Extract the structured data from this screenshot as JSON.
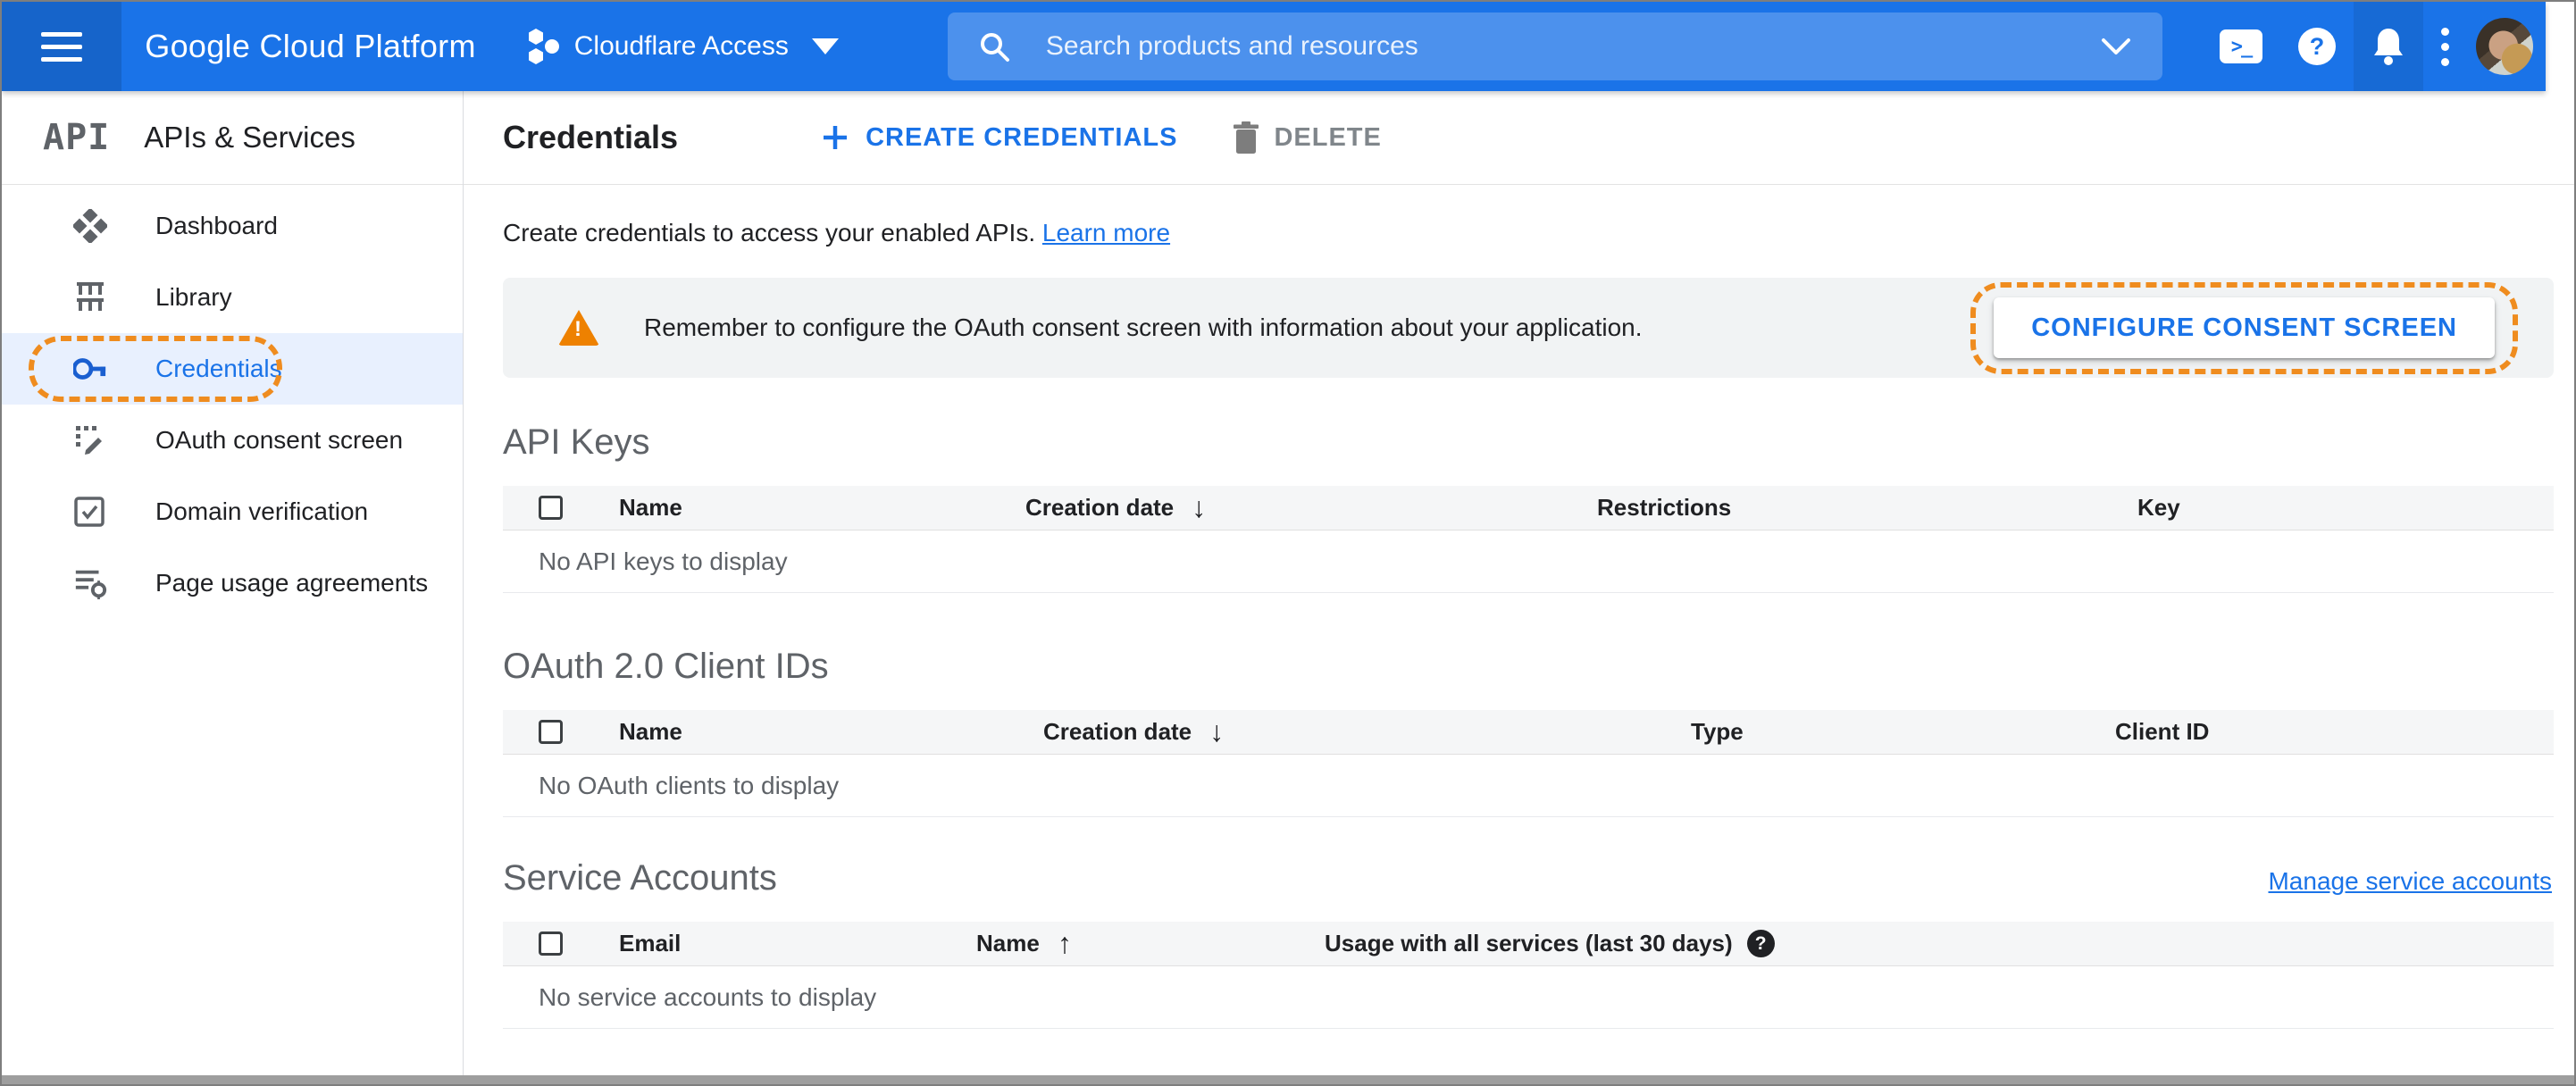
{
  "topbar": {
    "brand": "Google Cloud Platform",
    "project": "Cloudflare Access",
    "search_placeholder": "Search products and resources"
  },
  "sidebar": {
    "product_glyph": "API",
    "title": "APIs & Services",
    "items": [
      {
        "label": "Dashboard",
        "active": false
      },
      {
        "label": "Library",
        "active": false
      },
      {
        "label": "Credentials",
        "active": true,
        "annotated": "orange-dashed-highlight"
      },
      {
        "label": "OAuth consent screen",
        "active": false
      },
      {
        "label": "Domain verification",
        "active": false
      },
      {
        "label": "Page usage agreements",
        "active": false
      }
    ]
  },
  "main": {
    "toolbar": {
      "title": "Credentials",
      "create_label": "CREATE CREDENTIALS",
      "delete_label": "DELETE",
      "delete_enabled": false
    },
    "description": {
      "text": "Create credentials to access your enabled APIs.",
      "link_label": "Learn more"
    },
    "banner": {
      "message": "Remember to configure the OAuth consent screen with information about your application.",
      "action_label": "CONFIGURE CONSENT SCREEN",
      "annotated": "orange-dashed-highlight"
    },
    "sections": [
      {
        "title": "API Keys",
        "columns": [
          {
            "label": "Name"
          },
          {
            "label": "Creation date",
            "sort": "desc",
            "sort_icon": "↓"
          },
          {
            "label": "Restrictions"
          },
          {
            "label": "Key"
          }
        ],
        "empty": "No API keys to display"
      },
      {
        "title": "OAuth 2.0 Client IDs",
        "columns": [
          {
            "label": "Name"
          },
          {
            "label": "Creation date",
            "sort": "desc",
            "sort_icon": "↓"
          },
          {
            "label": "Type"
          },
          {
            "label": "Client ID"
          }
        ],
        "empty": "No OAuth clients to display"
      },
      {
        "title": "Service Accounts",
        "link_label": "Manage service accounts",
        "columns": [
          {
            "label": "Email"
          },
          {
            "label": "Name",
            "sort": "asc",
            "sort_icon": "↑"
          },
          {
            "label": "Usage with all services (last 30 days)",
            "help": true
          }
        ],
        "empty": "No service accounts to display"
      }
    ]
  },
  "colors": {
    "topbar_blue": "#1a73e8",
    "accent_blue": "#1a73e8",
    "active_nav_bg": "#e8f0fe",
    "annotation_orange": "#ef8c1f",
    "warning_orange": "#ee8100",
    "banner_bg": "#f1f3f4",
    "table_header_bg": "#f5f6f7"
  }
}
